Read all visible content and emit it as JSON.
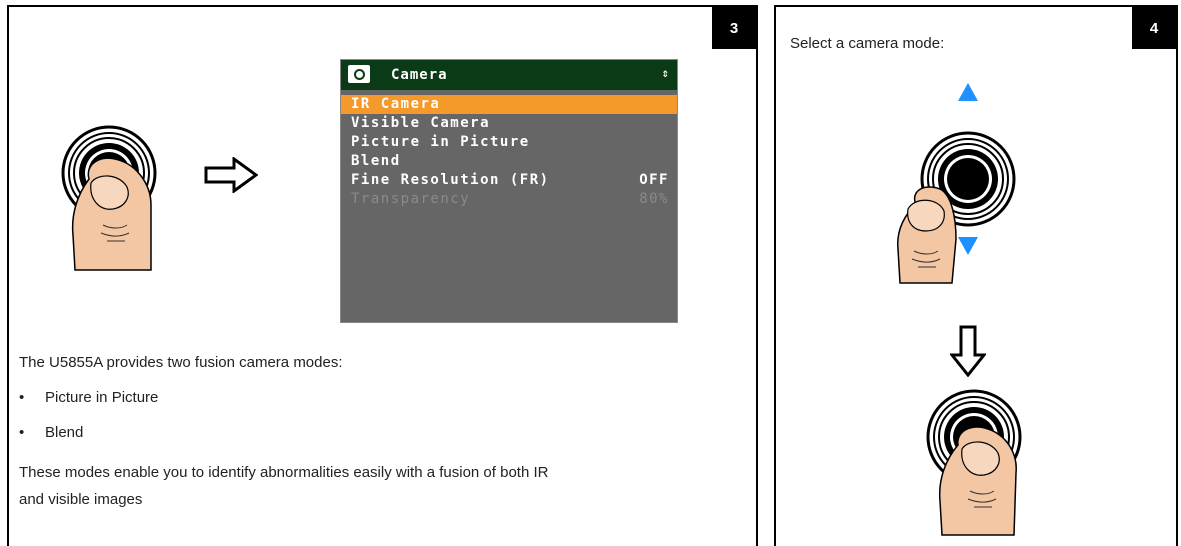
{
  "step3": {
    "number": "3",
    "menu": {
      "title": "Camera",
      "items": [
        {
          "label": "IR Camera",
          "value": ""
        },
        {
          "label": "Visible Camera",
          "value": ""
        },
        {
          "label": "Picture in Picture",
          "value": ""
        },
        {
          "label": "Blend",
          "value": ""
        },
        {
          "label": "Fine Resolution (FR)",
          "value": "OFF"
        },
        {
          "label": "Transparency",
          "value": "80%"
        }
      ],
      "selected_index": 0
    },
    "intro": "The U5855A provides two fusion camera modes:",
    "bullets": [
      "Picture in Picture",
      "Blend"
    ],
    "paragraph_line1": "These modes enable you to identify abnormalities easily with a fusion of both IR",
    "paragraph_line2": "and visible images",
    "colors": {
      "header": "#0b3a17",
      "screen": "#666666",
      "highlight": "#f39a2a"
    }
  },
  "step4": {
    "number": "4",
    "instruction": "Select a camera mode:",
    "colors": {
      "arrow": "#1e90ff"
    }
  }
}
